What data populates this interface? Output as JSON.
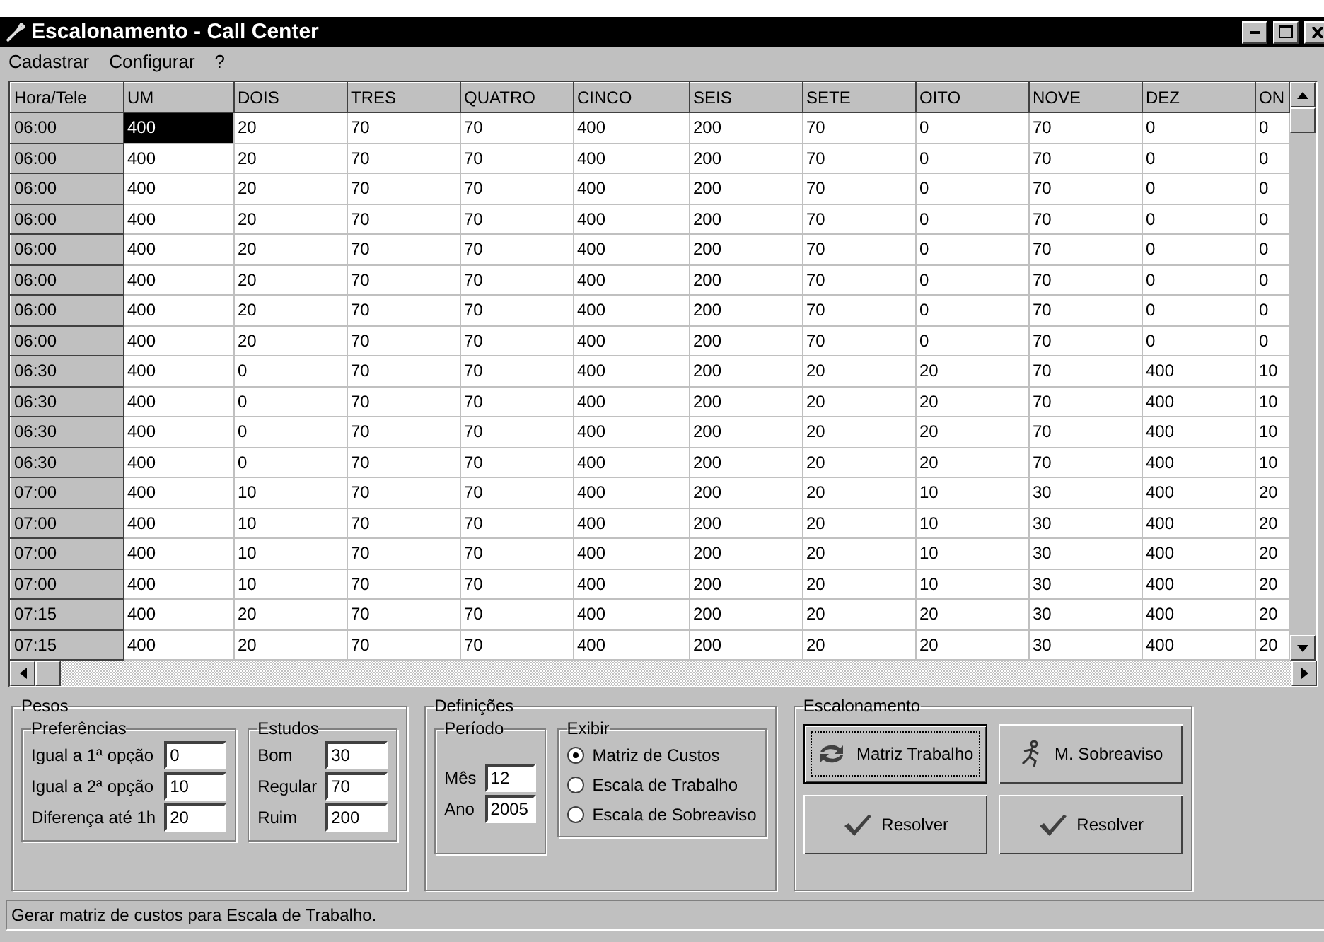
{
  "window": {
    "title": "Escalonamento - Call Center"
  },
  "menu": [
    {
      "label": "Cadastrar"
    },
    {
      "label": "Configurar"
    },
    {
      "label": "?"
    }
  ],
  "grid": {
    "columns": [
      "Hora/Tele",
      "UM",
      "DOIS",
      "TRES",
      "QUATRO",
      "CINCO",
      "SEIS",
      "SETE",
      "OITO",
      "NOVE",
      "DEZ",
      "ON"
    ],
    "rows": [
      {
        "cells": [
          "06:00",
          "400",
          "20",
          "70",
          "70",
          "400",
          "200",
          "70",
          "0",
          "70",
          "0",
          "0"
        ],
        "selected": [
          false,
          true,
          false,
          false,
          false,
          false,
          false,
          false,
          false,
          false,
          false,
          false
        ]
      },
      {
        "cells": [
          "06:00",
          "400",
          "20",
          "70",
          "70",
          "400",
          "200",
          "70",
          "0",
          "70",
          "0",
          "0"
        ],
        "selected": [
          false,
          false,
          false,
          false,
          false,
          false,
          false,
          false,
          false,
          false,
          false,
          false
        ]
      },
      {
        "cells": [
          "06:00",
          "400",
          "20",
          "70",
          "70",
          "400",
          "200",
          "70",
          "0",
          "70",
          "0",
          "0"
        ],
        "selected": [
          false,
          false,
          false,
          false,
          false,
          false,
          false,
          false,
          false,
          false,
          false,
          false
        ]
      },
      {
        "cells": [
          "06:00",
          "400",
          "20",
          "70",
          "70",
          "400",
          "200",
          "70",
          "0",
          "70",
          "0",
          "0"
        ],
        "selected": [
          false,
          false,
          false,
          false,
          false,
          false,
          false,
          false,
          false,
          false,
          false,
          false
        ]
      },
      {
        "cells": [
          "06:00",
          "400",
          "20",
          "70",
          "70",
          "400",
          "200",
          "70",
          "0",
          "70",
          "0",
          "0"
        ],
        "selected": [
          false,
          false,
          false,
          false,
          false,
          false,
          false,
          false,
          false,
          false,
          false,
          false
        ]
      },
      {
        "cells": [
          "06:00",
          "400",
          "20",
          "70",
          "70",
          "400",
          "200",
          "70",
          "0",
          "70",
          "0",
          "0"
        ],
        "selected": [
          false,
          false,
          false,
          false,
          false,
          false,
          false,
          false,
          false,
          false,
          false,
          false
        ]
      },
      {
        "cells": [
          "06:00",
          "400",
          "20",
          "70",
          "70",
          "400",
          "200",
          "70",
          "0",
          "70",
          "0",
          "0"
        ],
        "selected": [
          false,
          false,
          false,
          false,
          false,
          false,
          false,
          false,
          false,
          false,
          false,
          false
        ]
      },
      {
        "cells": [
          "06:00",
          "400",
          "20",
          "70",
          "70",
          "400",
          "200",
          "70",
          "0",
          "70",
          "0",
          "0"
        ],
        "selected": [
          false,
          false,
          false,
          false,
          false,
          false,
          false,
          false,
          false,
          false,
          false,
          false
        ]
      },
      {
        "cells": [
          "06:30",
          "400",
          "0",
          "70",
          "70",
          "400",
          "200",
          "20",
          "20",
          "70",
          "400",
          "10"
        ],
        "selected": [
          false,
          false,
          false,
          false,
          false,
          false,
          false,
          false,
          false,
          false,
          false,
          false
        ]
      },
      {
        "cells": [
          "06:30",
          "400",
          "0",
          "70",
          "70",
          "400",
          "200",
          "20",
          "20",
          "70",
          "400",
          "10"
        ],
        "selected": [
          false,
          false,
          false,
          false,
          false,
          false,
          false,
          false,
          false,
          false,
          false,
          false
        ]
      },
      {
        "cells": [
          "06:30",
          "400",
          "0",
          "70",
          "70",
          "400",
          "200",
          "20",
          "20",
          "70",
          "400",
          "10"
        ],
        "selected": [
          false,
          false,
          false,
          false,
          false,
          false,
          false,
          false,
          false,
          false,
          false,
          false
        ]
      },
      {
        "cells": [
          "06:30",
          "400",
          "0",
          "70",
          "70",
          "400",
          "200",
          "20",
          "20",
          "70",
          "400",
          "10"
        ],
        "selected": [
          false,
          false,
          false,
          false,
          false,
          false,
          false,
          false,
          false,
          false,
          false,
          false
        ]
      },
      {
        "cells": [
          "07:00",
          "400",
          "10",
          "70",
          "70",
          "400",
          "200",
          "20",
          "10",
          "30",
          "400",
          "20"
        ],
        "selected": [
          false,
          false,
          false,
          false,
          false,
          false,
          false,
          false,
          false,
          false,
          false,
          false
        ]
      },
      {
        "cells": [
          "07:00",
          "400",
          "10",
          "70",
          "70",
          "400",
          "200",
          "20",
          "10",
          "30",
          "400",
          "20"
        ],
        "selected": [
          false,
          false,
          false,
          false,
          false,
          false,
          false,
          false,
          false,
          false,
          false,
          false
        ]
      },
      {
        "cells": [
          "07:00",
          "400",
          "10",
          "70",
          "70",
          "400",
          "200",
          "20",
          "10",
          "30",
          "400",
          "20"
        ],
        "selected": [
          false,
          false,
          false,
          false,
          false,
          false,
          false,
          false,
          false,
          false,
          false,
          false
        ]
      },
      {
        "cells": [
          "07:00",
          "400",
          "10",
          "70",
          "70",
          "400",
          "200",
          "20",
          "10",
          "30",
          "400",
          "20"
        ],
        "selected": [
          false,
          false,
          false,
          false,
          false,
          false,
          false,
          false,
          false,
          false,
          false,
          false
        ]
      },
      {
        "cells": [
          "07:15",
          "400",
          "20",
          "70",
          "70",
          "400",
          "200",
          "20",
          "20",
          "30",
          "400",
          "20"
        ],
        "selected": [
          false,
          false,
          false,
          false,
          false,
          false,
          false,
          false,
          false,
          false,
          false,
          false
        ]
      },
      {
        "cells": [
          "07:15",
          "400",
          "20",
          "70",
          "70",
          "400",
          "200",
          "20",
          "20",
          "30",
          "400",
          "20"
        ],
        "selected": [
          false,
          false,
          false,
          false,
          false,
          false,
          false,
          false,
          false,
          false,
          false,
          false
        ]
      }
    ]
  },
  "pesos": {
    "title": "Pesos",
    "preferencias": {
      "title": "Preferências",
      "fields": [
        {
          "label": "Igual a 1ª opção",
          "value": "0"
        },
        {
          "label": "Igual a 2ª opção",
          "value": "10"
        },
        {
          "label": "Diferença até 1h",
          "value": "20"
        }
      ]
    },
    "estudos": {
      "title": "Estudos",
      "fields": [
        {
          "label": "Bom",
          "value": "30"
        },
        {
          "label": "Regular",
          "value": "70"
        },
        {
          "label": "Ruim",
          "value": "200"
        }
      ]
    }
  },
  "definicoes": {
    "title": "Definições",
    "periodo": {
      "title": "Período",
      "fields": [
        {
          "label": "Mês",
          "value": "12"
        },
        {
          "label": "Ano",
          "value": "2005"
        }
      ]
    },
    "exibir": {
      "title": "Exibir",
      "options": [
        {
          "label": "Matriz de Custos",
          "selected": true
        },
        {
          "label": "Escala de Trabalho",
          "selected": false
        },
        {
          "label": "Escala de Sobreaviso",
          "selected": false
        }
      ]
    }
  },
  "escalonamento": {
    "title": "Escalonamento",
    "buttons": [
      {
        "label": "Matriz Trabalho",
        "kind": "refresh",
        "focused": true
      },
      {
        "label": "M. Sobreaviso",
        "kind": "runner",
        "focused": false
      },
      {
        "label": "Resolver",
        "kind": "check",
        "focused": false
      },
      {
        "label": "Resolver",
        "kind": "check",
        "focused": false
      }
    ]
  },
  "status_bar": "Gerar matriz de custos para Escala de Trabalho."
}
